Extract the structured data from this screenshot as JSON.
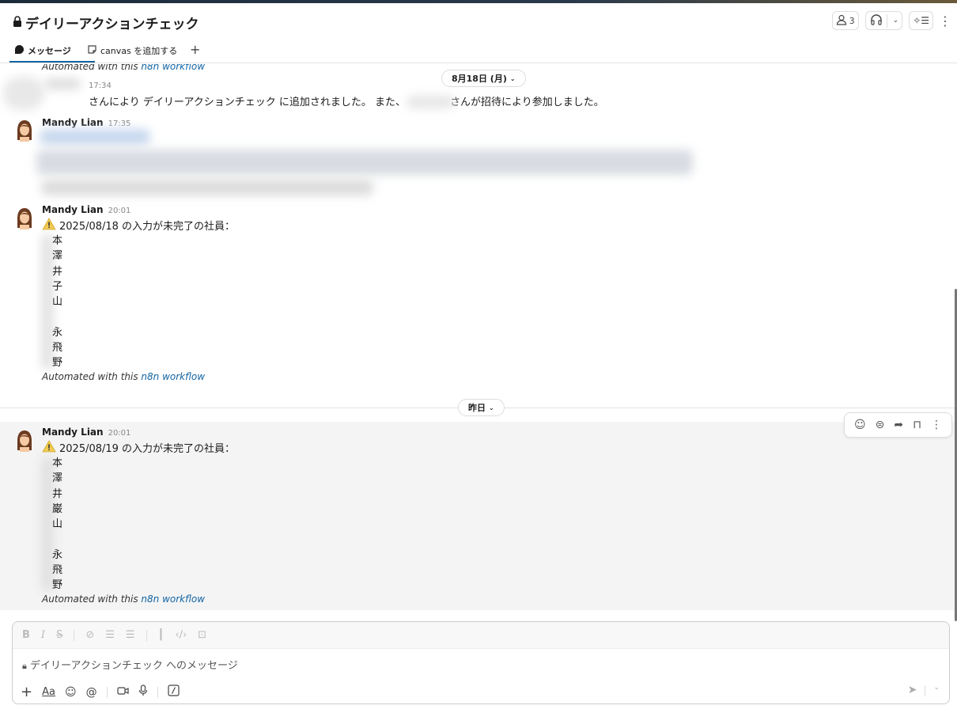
{
  "channel": {
    "title": "デイリーアクションチェック",
    "member_count": "3"
  },
  "tabs": [
    {
      "label": "メッセージ"
    },
    {
      "label": "canvas を追加する"
    }
  ],
  "feed": {
    "top_auto_text": "Automated with this ",
    "top_auto_link": "n8n workflow",
    "date_pill_1": "8月18日 (月)",
    "sys_msg": {
      "time": "17:34",
      "text_a": "さんにより デイリーアクションチェック に追加されました。 また、",
      "text_b": "さんが招待により参加しました。"
    },
    "msg1": {
      "sender": "Mandy Lian",
      "time": "17:35"
    },
    "msg2": {
      "sender": "Mandy Lian",
      "time": "20:01",
      "headline": "2025/08/18 の入力が未完了の社員：",
      "names": [
        "本",
        "澤",
        "井",
        "子",
        "山",
        "",
        "永",
        "飛",
        "野"
      ],
      "auto_text": "Automated with this ",
      "auto_link": "n8n workflow"
    },
    "date_pill_2": "昨日",
    "msg3": {
      "sender": "Mandy Lian",
      "time": "20:01",
      "headline": "2025/08/19 の入力が未完了の社員：",
      "names": [
        "本",
        "澤",
        "井",
        "巌",
        "山",
        "",
        "永",
        "飛",
        "野"
      ],
      "auto_text": "Automated with this ",
      "auto_link": "n8n workflow"
    }
  },
  "composer": {
    "placeholder": "デイリーアクションチェック へのメッセージ",
    "aa": "Aa"
  },
  "colors": {
    "link": "#1264a3",
    "warning": "#f2c94c"
  }
}
